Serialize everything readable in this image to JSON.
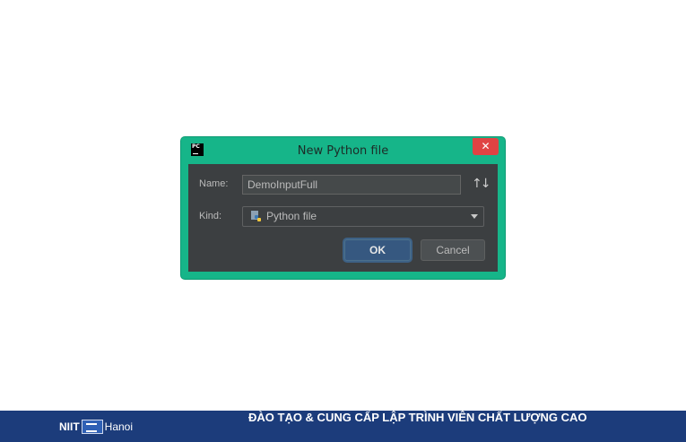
{
  "dialog": {
    "title": "New Python file",
    "app_icon_text": "PC",
    "close_icon": "close-icon",
    "name_label": "Name:",
    "name_value": "DemoInputFull",
    "sort_icon": "↑↓",
    "kind_label": "Kind:",
    "kind_value": "Python file",
    "ok_label": "OK",
    "cancel_label": "Cancel",
    "colors": {
      "frame": "#16b589",
      "content": "#3c3f41",
      "close": "#e04343",
      "ok": "#365880"
    }
  },
  "footer": {
    "logo_left": "NIIT",
    "logo_right": "Hanoi",
    "slogan": "ĐÀO TẠO & CUNG CẤP LẬP TRÌNH VIÊN CHẤT LƯỢNG CAO",
    "background": "#1c3c7b"
  }
}
